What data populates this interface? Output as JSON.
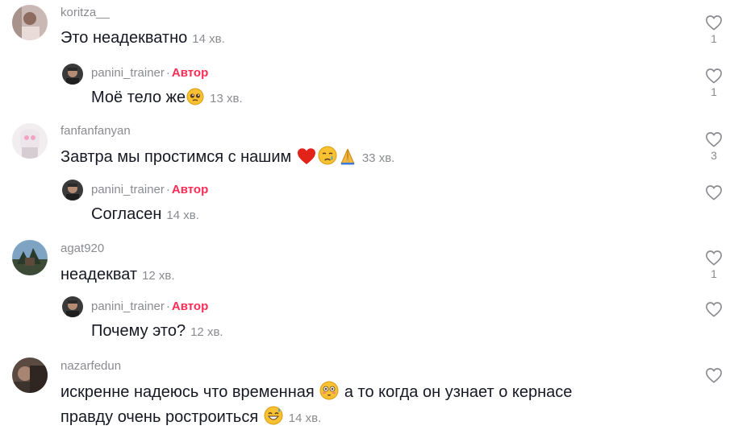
{
  "comments": [
    {
      "username": "koritza__",
      "text": "Это неадекватно",
      "time": "14 хв.",
      "likes": "1"
    },
    {
      "username": "panini_trainer",
      "tag": "Автор",
      "text": "Моё тело же",
      "time": "13 хв.",
      "likes": "1"
    },
    {
      "username": "fanfanfanyan",
      "text": "Завтра мы простимся с нашим",
      "time": "33 хв.",
      "likes": "3"
    },
    {
      "username": "panini_trainer",
      "tag": "Автор",
      "text": "Согласен",
      "time": "14 хв.",
      "likes": ""
    },
    {
      "username": "agat920",
      "text": "неадекват",
      "time": "12 хв.",
      "likes": "1"
    },
    {
      "username": "panini_trainer",
      "tag": "Автор",
      "text": "Почему это?",
      "time": "12 хв.",
      "likes": ""
    },
    {
      "username": "nazarfedun",
      "text_line1_a": "искренне надеюсь что временная",
      "text_line1_b": "а то когда он узнает о кернасе",
      "text_line2": "правду очень ростроиться",
      "time": "14 хв.",
      "likes": ""
    }
  ],
  "separator": "·",
  "icons": {
    "like": "heart-outline-icon",
    "emoji_pleading": "pleading-face",
    "emoji_heart": "red-heart",
    "emoji_tear": "crying-face",
    "emoji_pray": "folded-hands",
    "emoji_flushed": "flushed-face",
    "emoji_grin_sweat": "grinning-sweat-face"
  },
  "colors": {
    "author_tag": "#fe2c55",
    "meta": "#8a8b91",
    "text": "#161823"
  }
}
